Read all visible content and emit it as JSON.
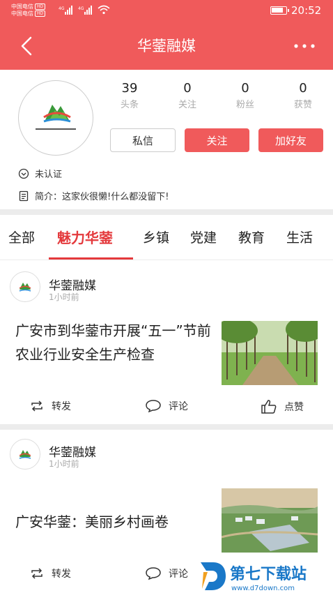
{
  "status_bar": {
    "carrier_1": "中国电信",
    "carrier_2": "中国电信",
    "hd_1": "HD",
    "hd_2": "HD",
    "net_1": "4G",
    "net_2": "4G",
    "time": "20:52"
  },
  "header": {
    "title": "华蓥融媒",
    "back_icon": "chevron-left-icon",
    "more_icon": "more-dots-icon"
  },
  "profile": {
    "stats": [
      {
        "value": "39",
        "label": "头条"
      },
      {
        "value": "0",
        "label": "关注"
      },
      {
        "value": "0",
        "label": "粉丝"
      },
      {
        "value": "0",
        "label": "获赞"
      }
    ],
    "buttons": {
      "message": "私信",
      "follow": "关注",
      "add_friend": "加好友"
    },
    "verification": "未认证",
    "intro": "简介：这家伙很懒!什么都没留下!"
  },
  "tabs": [
    {
      "label": "全部",
      "active": false
    },
    {
      "label": "魅力华蓥",
      "active": true
    },
    {
      "label": "乡镇",
      "active": false
    },
    {
      "label": "党建",
      "active": false
    },
    {
      "label": "教育",
      "active": false
    },
    {
      "label": "生活",
      "active": false
    }
  ],
  "feed": [
    {
      "author": "华蓥融媒",
      "time": "1小时前",
      "title": "广安市到华蓥市开展“五一”节前农业行业安全生产检查",
      "thumb_icon": "tree-road-photo",
      "actions": {
        "repost": "转发",
        "comment": "评论",
        "like": "点赞"
      }
    },
    {
      "author": "华蓥融媒",
      "time": "1小时前",
      "title": "广安华蓥：美丽乡村画卷",
      "thumb_icon": "village-aerial-photo",
      "actions": {
        "repost": "转发",
        "comment": "评论"
      }
    }
  ],
  "watermark": {
    "name": "第七下载站",
    "url": "www.d7down.com"
  },
  "colors": {
    "brand": "#f05a5b",
    "active_tab": "#e4393c",
    "muted": "#aaaaaa",
    "divider": "#ececec"
  }
}
